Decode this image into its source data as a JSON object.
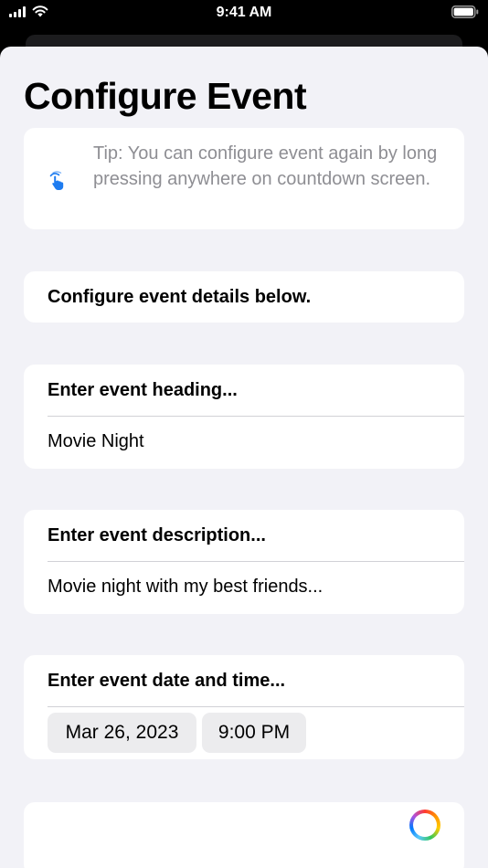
{
  "status_bar": {
    "time": "9:41 AM"
  },
  "page": {
    "title": "Configure Event"
  },
  "tip": {
    "text": "Tip: You can configure event again by long pressing anywhere on countdown screen."
  },
  "details": {
    "heading": "Configure event details below."
  },
  "event_heading": {
    "label": "Enter event heading...",
    "value": "Movie Night"
  },
  "event_description": {
    "label": "Enter event description...",
    "value": "Movie night with my best friends..."
  },
  "event_datetime": {
    "label": "Enter event date and time...",
    "date": "Mar 26, 2023",
    "time": "9:00 PM"
  },
  "colors": {
    "accent": "#007aff",
    "tip_icon": "#1e7cf0",
    "background": "#f2f2f7"
  },
  "icons": {
    "tip": "hand-tap-icon",
    "color_picker": "color-wheel-icon"
  }
}
